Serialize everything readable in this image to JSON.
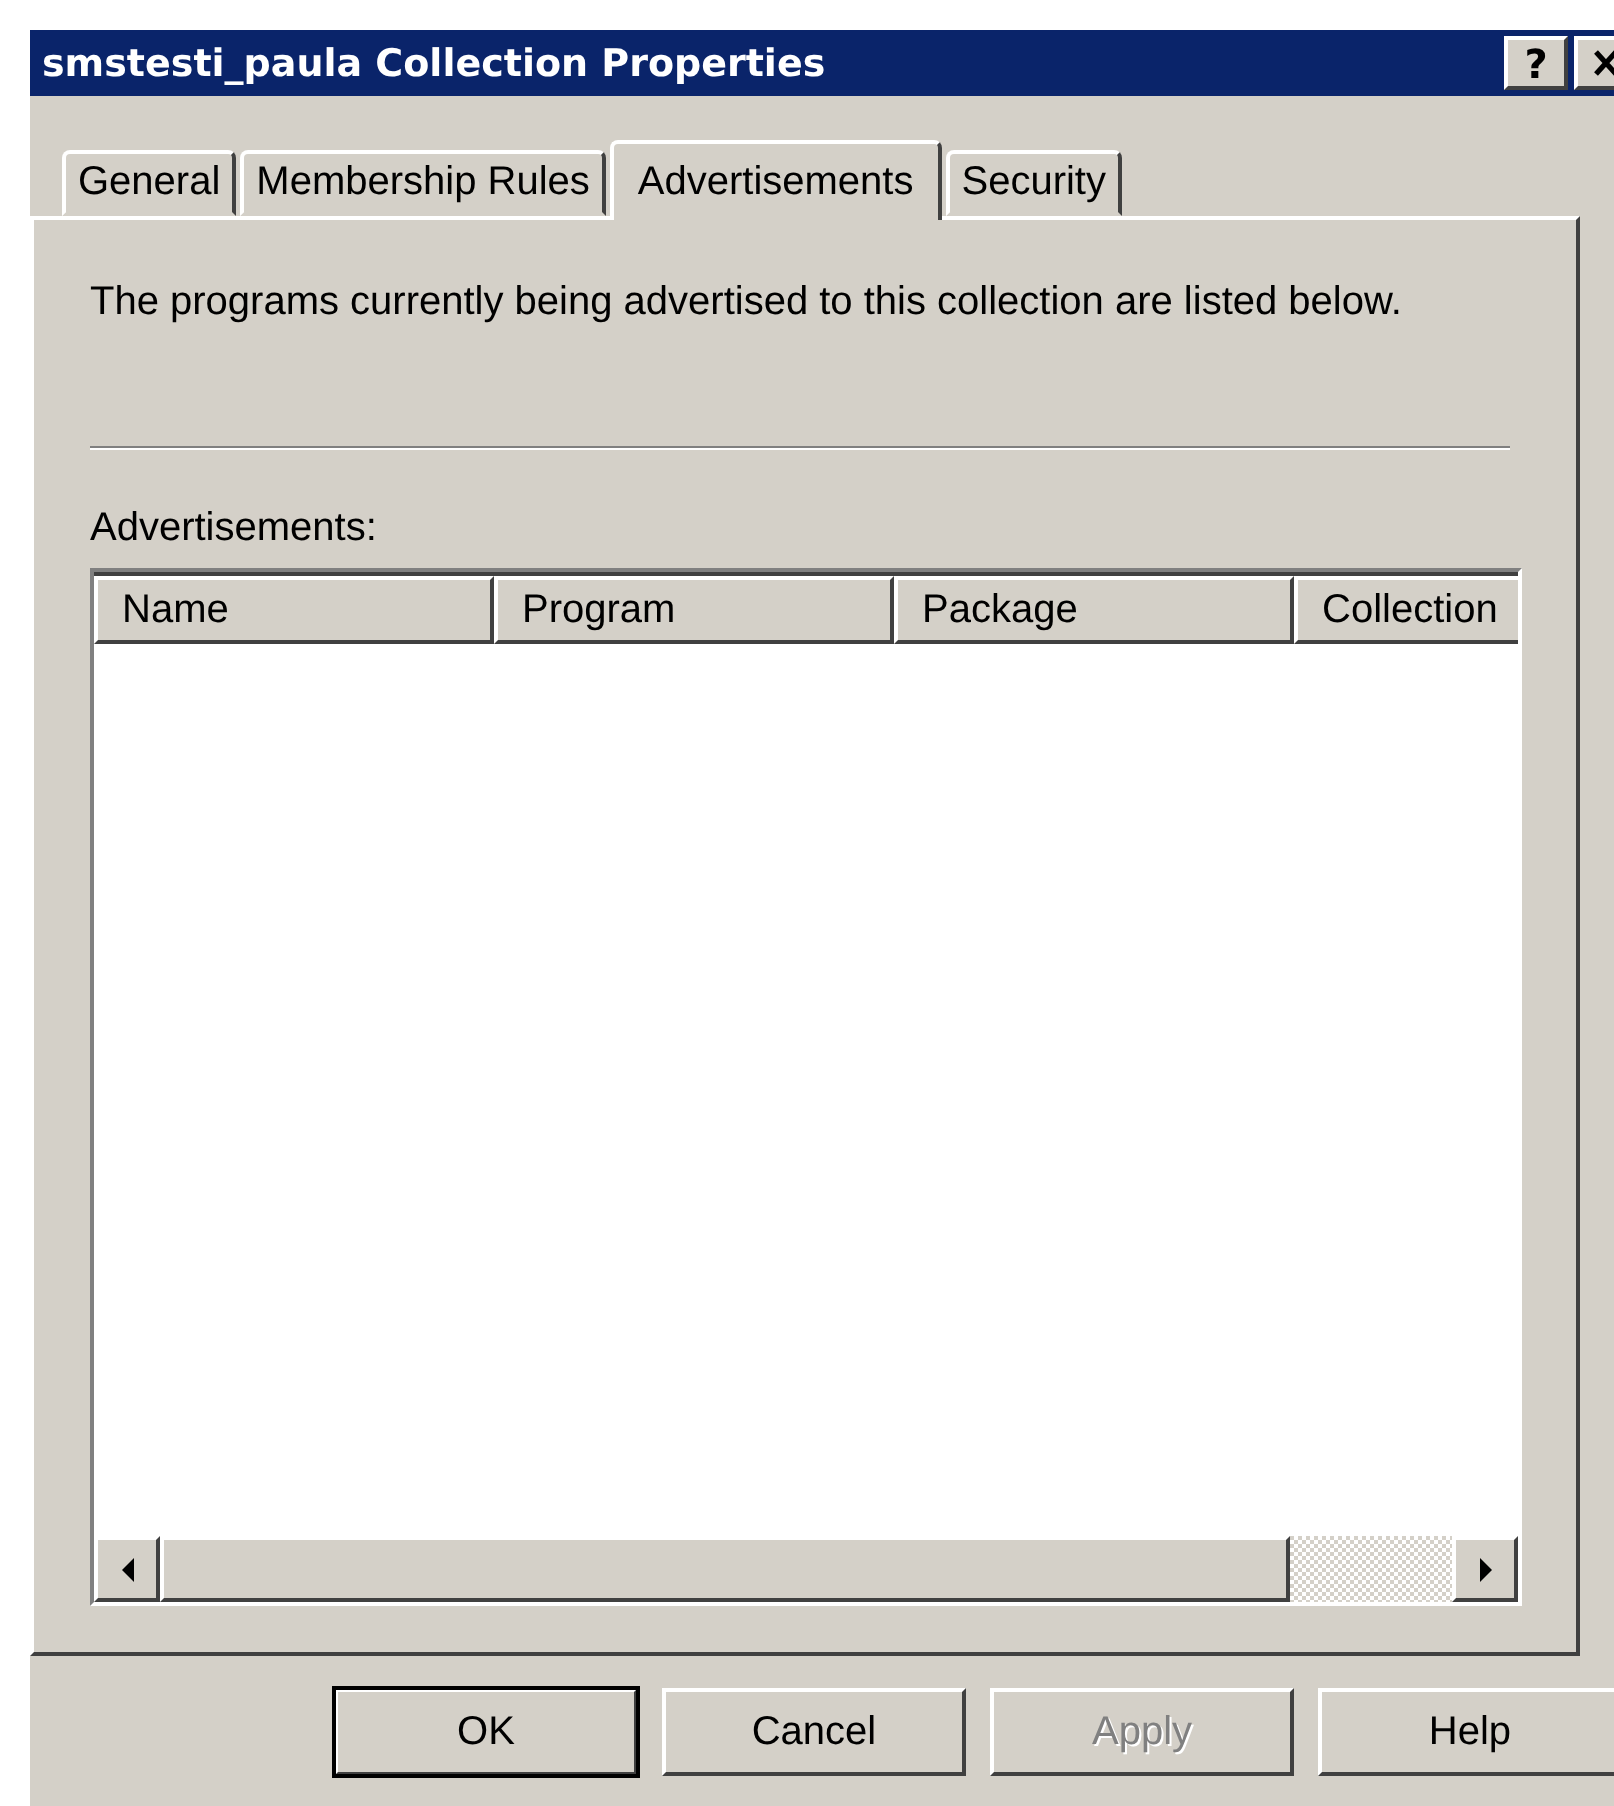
{
  "window": {
    "title": "smstesti_paula Collection Properties",
    "help_button": "?"
  },
  "tabs": [
    {
      "label": "General",
      "selected": false
    },
    {
      "label": "Membership Rules",
      "selected": false
    },
    {
      "label": "Advertisements",
      "selected": true
    },
    {
      "label": "Security",
      "selected": false
    }
  ],
  "description": "The programs currently being advertised to this collection are listed below.",
  "advertisements_label": "Advertisements:",
  "table": {
    "columns": [
      "Name",
      "Program",
      "Package",
      "Collection"
    ]
  },
  "buttons": [
    {
      "label": "OK",
      "default": true,
      "disabled": false
    },
    {
      "label": "Cancel",
      "default": false,
      "disabled": false
    },
    {
      "label": "Apply",
      "default": false,
      "disabled": true
    },
    {
      "label": "Help",
      "default": false,
      "disabled": false
    }
  ]
}
